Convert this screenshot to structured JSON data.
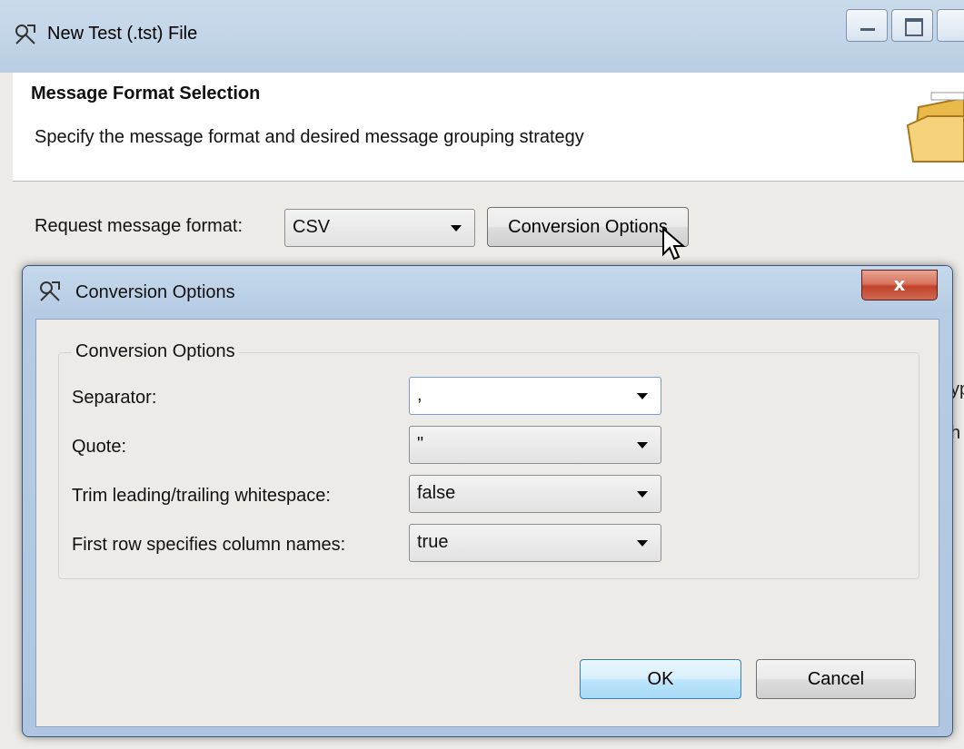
{
  "outer": {
    "title": "New Test (.tst) File",
    "banner_title": "Message Format Selection",
    "banner_subtitle": "Specify the message format and desired message grouping strategy",
    "request_format_label": "Request message format:",
    "request_format_value": "CSV",
    "conversion_options_button": "Conversion Options",
    "side_text_1": "yp",
    "side_text_2": "h"
  },
  "dialog": {
    "title": "Conversion Options",
    "close_label": "x",
    "group_title": "Conversion Options",
    "fields": [
      {
        "label": "Separator:",
        "value": ","
      },
      {
        "label": "Quote:",
        "value": "\""
      },
      {
        "label": "Trim leading/trailing whitespace:",
        "value": "false"
      },
      {
        "label": "First row specifies column names:",
        "value": "true"
      }
    ],
    "ok_label": "OK",
    "cancel_label": "Cancel"
  },
  "colors": {
    "titlebar": "#c4d6e8",
    "close_button": "#c2412a",
    "window_body": "#ecebe8"
  },
  "icons": [
    "app-icon",
    "folder-icon",
    "minimize-icon",
    "maximize-icon",
    "close-icon",
    "dropdown-arrow-icon",
    "mouse-cursor-icon"
  ]
}
